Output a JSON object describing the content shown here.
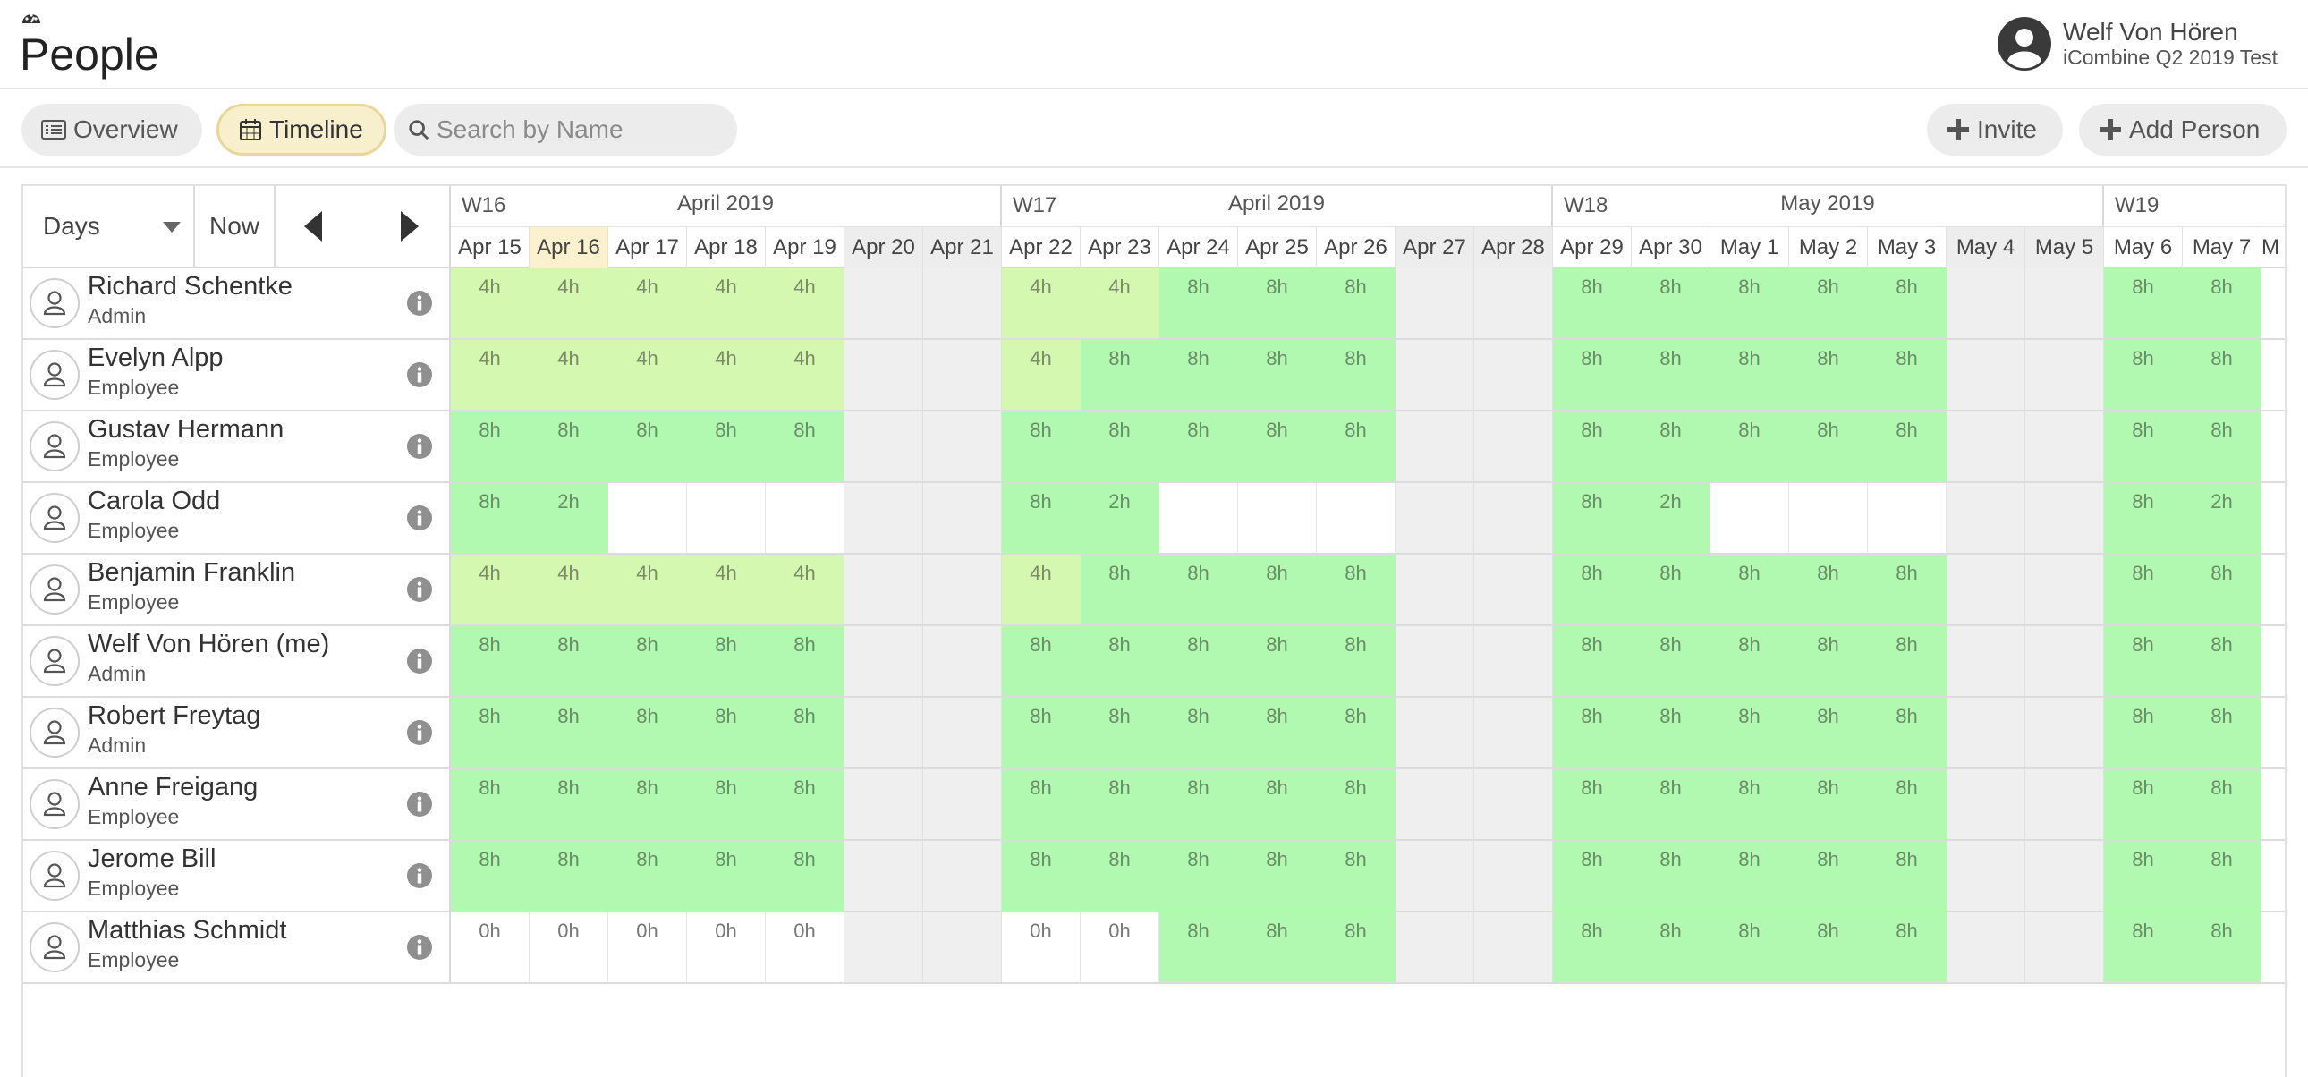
{
  "header": {
    "title": "People",
    "app_icon": "dashboard-icon",
    "user_name": "Welf Von Hören",
    "user_org": "iCombine Q2 2019 Test"
  },
  "toolbar": {
    "overview_label": "Overview",
    "timeline_label": "Timeline",
    "search_placeholder": "Search by Name",
    "search_value": "",
    "invite_label": "Invite",
    "add_person_label": "Add Person"
  },
  "controls": {
    "range_select": "Days",
    "now_label": "Now"
  },
  "colors": {
    "full_day": "#b1f9b0",
    "partial_day": "#d5f8b0",
    "weekend": "#efefef",
    "today": "#fbf1cf",
    "timeline_active": "#f8efcd"
  },
  "weeks": [
    {
      "label": "W16",
      "month": "April 2019"
    },
    {
      "label": "W17",
      "month": "April 2019"
    },
    {
      "label": "W18",
      "month": "May 2019"
    },
    {
      "label": "W19",
      "month": ""
    }
  ],
  "days": [
    {
      "label": "Apr 15",
      "weekend": false,
      "today": false
    },
    {
      "label": "Apr 16",
      "weekend": false,
      "today": true
    },
    {
      "label": "Apr 17",
      "weekend": false,
      "today": false
    },
    {
      "label": "Apr 18",
      "weekend": false,
      "today": false
    },
    {
      "label": "Apr 19",
      "weekend": false,
      "today": false
    },
    {
      "label": "Apr 20",
      "weekend": true,
      "today": false
    },
    {
      "label": "Apr 21",
      "weekend": true,
      "today": false
    },
    {
      "label": "Apr 22",
      "weekend": false,
      "today": false
    },
    {
      "label": "Apr 23",
      "weekend": false,
      "today": false
    },
    {
      "label": "Apr 24",
      "weekend": false,
      "today": false
    },
    {
      "label": "Apr 25",
      "weekend": false,
      "today": false
    },
    {
      "label": "Apr 26",
      "weekend": false,
      "today": false
    },
    {
      "label": "Apr 27",
      "weekend": true,
      "today": false
    },
    {
      "label": "Apr 28",
      "weekend": true,
      "today": false
    },
    {
      "label": "Apr 29",
      "weekend": false,
      "today": false
    },
    {
      "label": "Apr 30",
      "weekend": false,
      "today": false
    },
    {
      "label": "May 1",
      "weekend": false,
      "today": false
    },
    {
      "label": "May 2",
      "weekend": false,
      "today": false
    },
    {
      "label": "May 3",
      "weekend": false,
      "today": false
    },
    {
      "label": "May 4",
      "weekend": true,
      "today": false
    },
    {
      "label": "May 5",
      "weekend": true,
      "today": false
    },
    {
      "label": "May 6",
      "weekend": false,
      "today": false
    },
    {
      "label": "May 7",
      "weekend": false,
      "today": false
    },
    {
      "label": "M",
      "weekend": false,
      "today": false
    }
  ],
  "people": [
    {
      "name": "Richard Schentke",
      "role": "Admin",
      "hours": [
        "4h",
        "4h",
        "4h",
        "4h",
        "4h",
        "",
        "",
        "4h",
        "4h",
        "8h",
        "8h",
        "8h",
        "",
        "",
        "8h",
        "8h",
        "8h",
        "8h",
        "8h",
        "",
        "",
        "8h",
        "8h",
        ""
      ]
    },
    {
      "name": "Evelyn Alpp",
      "role": "Employee",
      "hours": [
        "4h",
        "4h",
        "4h",
        "4h",
        "4h",
        "",
        "",
        "4h",
        "8h",
        "8h",
        "8h",
        "8h",
        "",
        "",
        "8h",
        "8h",
        "8h",
        "8h",
        "8h",
        "",
        "",
        "8h",
        "8h",
        ""
      ]
    },
    {
      "name": "Gustav Hermann",
      "role": "Employee",
      "hours": [
        "8h",
        "8h",
        "8h",
        "8h",
        "8h",
        "",
        "",
        "8h",
        "8h",
        "8h",
        "8h",
        "8h",
        "",
        "",
        "8h",
        "8h",
        "8h",
        "8h",
        "8h",
        "",
        "",
        "8h",
        "8h",
        ""
      ]
    },
    {
      "name": "Carola Odd",
      "role": "Employee",
      "hours": [
        "8h",
        "2h",
        "",
        "",
        "",
        "",
        "",
        "8h",
        "2h",
        "",
        "",
        "",
        "",
        "",
        "8h",
        "2h",
        "",
        "",
        "",
        "",
        "",
        "8h",
        "2h",
        ""
      ]
    },
    {
      "name": "Benjamin Franklin",
      "role": "Employee",
      "hours": [
        "4h",
        "4h",
        "4h",
        "4h",
        "4h",
        "",
        "",
        "4h",
        "8h",
        "8h",
        "8h",
        "8h",
        "",
        "",
        "8h",
        "8h",
        "8h",
        "8h",
        "8h",
        "",
        "",
        "8h",
        "8h",
        ""
      ]
    },
    {
      "name": "Welf Von Hören (me)",
      "role": "Admin",
      "hours": [
        "8h",
        "8h",
        "8h",
        "8h",
        "8h",
        "",
        "",
        "8h",
        "8h",
        "8h",
        "8h",
        "8h",
        "",
        "",
        "8h",
        "8h",
        "8h",
        "8h",
        "8h",
        "",
        "",
        "8h",
        "8h",
        ""
      ]
    },
    {
      "name": "Robert Freytag",
      "role": "Admin",
      "hours": [
        "8h",
        "8h",
        "8h",
        "8h",
        "8h",
        "",
        "",
        "8h",
        "8h",
        "8h",
        "8h",
        "8h",
        "",
        "",
        "8h",
        "8h",
        "8h",
        "8h",
        "8h",
        "",
        "",
        "8h",
        "8h",
        ""
      ]
    },
    {
      "name": "Anne Freigang",
      "role": "Employee",
      "hours": [
        "8h",
        "8h",
        "8h",
        "8h",
        "8h",
        "",
        "",
        "8h",
        "8h",
        "8h",
        "8h",
        "8h",
        "",
        "",
        "8h",
        "8h",
        "8h",
        "8h",
        "8h",
        "",
        "",
        "8h",
        "8h",
        ""
      ]
    },
    {
      "name": "Jerome Bill",
      "role": "Employee",
      "hours": [
        "8h",
        "8h",
        "8h",
        "8h",
        "8h",
        "",
        "",
        "8h",
        "8h",
        "8h",
        "8h",
        "8h",
        "",
        "",
        "8h",
        "8h",
        "8h",
        "8h",
        "8h",
        "",
        "",
        "8h",
        "8h",
        ""
      ]
    },
    {
      "name": "Matthias Schmidt",
      "role": "Employee",
      "hours": [
        "0h",
        "0h",
        "0h",
        "0h",
        "0h",
        "",
        "",
        "0h",
        "0h",
        "8h",
        "8h",
        "8h",
        "",
        "",
        "8h",
        "8h",
        "8h",
        "8h",
        "8h",
        "",
        "",
        "8h",
        "8h",
        ""
      ]
    }
  ]
}
